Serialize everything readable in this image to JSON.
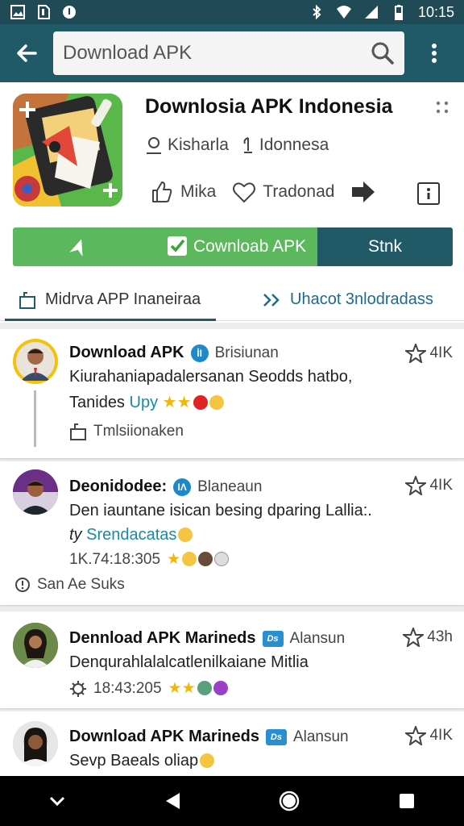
{
  "status": {
    "time": "10:15"
  },
  "search": {
    "value": "Download APK"
  },
  "app": {
    "title": "Downlosia APK Indonesia",
    "meta": [
      "Kisharla",
      "Idonnesa"
    ],
    "actions": [
      "Mika",
      "Tradonad"
    ],
    "download_label": "Cownloab APK",
    "sync_label": "Stnk"
  },
  "tabs": [
    {
      "label": "Midrva APP Inaneiraa"
    },
    {
      "label": "Uhacot 3nlodradass"
    }
  ],
  "posts": [
    {
      "name": "Download APK",
      "badge": "İƖ",
      "sub": "Brisiunan",
      "stars": "4IK",
      "line1": "Kiurahaniapadalersanan Seodds hatbo,",
      "line2_text": "Tanides ",
      "line2_link": "Upy",
      "footer": "Tmlsiionaken"
    },
    {
      "name": "Deonidodee:",
      "badge": "ƖΛ",
      "sub": "Blaneaun",
      "stars": "4IK",
      "line1": "Den iauntane isican besing dparing Lallia:.",
      "line2_prefix": "ty ",
      "line2_link": "Srendacatas",
      "time": "1K.74:18:305",
      "footer": "San Ae Suks"
    },
    {
      "name": "Dennload APK Marineds",
      "badge": "Ds",
      "sub": "Alansun",
      "stars": "43h",
      "line1": "Denqurahlalalcatlenilkaiane Mitlia",
      "time": "18:43:205"
    },
    {
      "name": "Download APK Marineds",
      "badge": "Ds",
      "sub": "Alansun",
      "stars": "4IK",
      "line1": "Sevp Baeals oliap"
    }
  ]
}
